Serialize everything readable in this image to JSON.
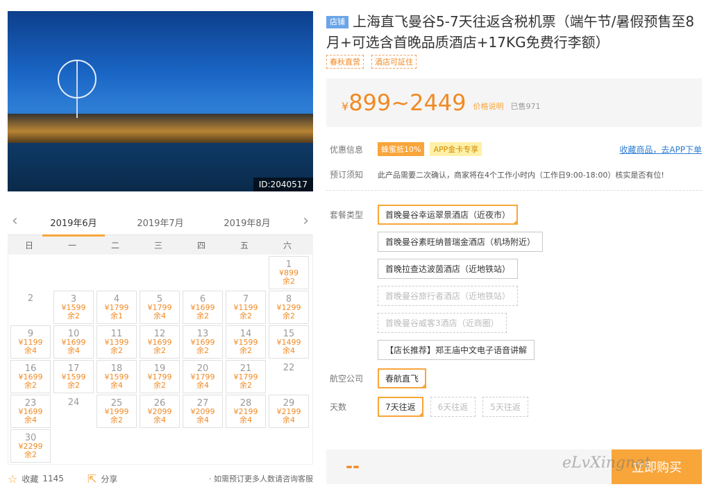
{
  "photo": {
    "id_label": "ID:2040517"
  },
  "calendar": {
    "months": [
      "2019年6月",
      "2019年7月",
      "2019年8月"
    ],
    "weekdays": [
      "日",
      "一",
      "二",
      "三",
      "四",
      "五",
      "六"
    ],
    "cells": [
      {
        "d": ""
      },
      {
        "d": ""
      },
      {
        "d": ""
      },
      {
        "d": ""
      },
      {
        "d": ""
      },
      {
        "d": ""
      },
      {
        "d": "1",
        "p": "¥899",
        "s": "余2"
      },
      {
        "d": "2"
      },
      {
        "d": "3",
        "p": "¥1599",
        "s": "余2"
      },
      {
        "d": "4",
        "p": "¥1799",
        "s": "余1"
      },
      {
        "d": "5",
        "p": "¥1799",
        "s": "余4"
      },
      {
        "d": "6",
        "p": "¥1699",
        "s": "余2"
      },
      {
        "d": "7",
        "p": "¥1199",
        "s": "余2"
      },
      {
        "d": "8",
        "p": "¥1299",
        "s": "余2"
      },
      {
        "d": "9",
        "p": "¥1199",
        "s": "余4"
      },
      {
        "d": "10",
        "p": "¥1699",
        "s": "余4"
      },
      {
        "d": "11",
        "p": "¥1399",
        "s": "余2"
      },
      {
        "d": "12",
        "p": "¥1699",
        "s": "余2"
      },
      {
        "d": "13",
        "p": "¥1699",
        "s": "余2"
      },
      {
        "d": "14",
        "p": "¥1599",
        "s": "余2"
      },
      {
        "d": "15",
        "p": "¥1499",
        "s": "余4"
      },
      {
        "d": "16",
        "p": "¥1699",
        "s": "余2"
      },
      {
        "d": "17",
        "p": "¥1599",
        "s": "余2"
      },
      {
        "d": "18",
        "p": "¥1599",
        "s": "余4"
      },
      {
        "d": "19",
        "p": "¥1799",
        "s": "余2"
      },
      {
        "d": "20",
        "p": "¥1799",
        "s": "余4"
      },
      {
        "d": "21",
        "p": "¥1799",
        "s": "余2"
      },
      {
        "d": "22"
      },
      {
        "d": "23",
        "p": "¥1699",
        "s": "余4"
      },
      {
        "d": "24"
      },
      {
        "d": "25",
        "p": "¥1999",
        "s": "余2"
      },
      {
        "d": "26",
        "p": "¥2099",
        "s": "余4"
      },
      {
        "d": "27",
        "p": "¥2099",
        "s": "余4"
      },
      {
        "d": "28",
        "p": "¥2199",
        "s": "余4"
      },
      {
        "d": "29",
        "p": "¥2199",
        "s": "余4"
      },
      {
        "d": "30",
        "p": "¥2299",
        "s": "余2"
      }
    ]
  },
  "footer": {
    "fav_label": "收藏",
    "fav_count": "1145",
    "share_label": "分享",
    "note": "· 如需预订更多人数请咨询客服"
  },
  "product": {
    "badge": "店铺",
    "title": "上海直飞曼谷5-7天往返含税机票（端午节/暑假预售至8月+可选含首晚品质酒店+17KG免费行李额）",
    "tags": [
      "春秋直营",
      "酒店可証住"
    ],
    "price_currency": "¥",
    "price": "899~2449",
    "price_explain": "价格说明",
    "sold": "已售971"
  },
  "promo": {
    "label": "优惠信息",
    "tag1": "蜂蜜抵10%",
    "tag2": "APP金卡专享",
    "fav_link": "收藏商品，去APP下单"
  },
  "notice": {
    "label": "预订须知",
    "text": "此产品需要二次确认，商家将在4个工作小时内（工作日9:00-18:00）核实是否有位!"
  },
  "package": {
    "label": "套餐类型",
    "options": [
      {
        "text": "首晚曼谷幸运翠景酒店（近夜市）",
        "state": "selected"
      },
      {
        "text": "首晚曼谷素旺纳普瑞金酒店（机场附近）",
        "state": "normal"
      },
      {
        "text": "首晚拉查达波茵酒店（近地铁站）",
        "state": "normal"
      },
      {
        "text": "首晚曼谷旅行者酒店（近地铁站）",
        "state": "disabled"
      },
      {
        "text": "首晚曼谷威客3酒店（近商圈）",
        "state": "disabled"
      },
      {
        "text": "【店长推荐】郑王庙中文电子语音讲解",
        "state": "normal"
      }
    ]
  },
  "airline": {
    "label": "航空公司",
    "option": "春航直飞"
  },
  "days": {
    "label": "天数",
    "options": [
      {
        "text": "7天往返",
        "state": "selected"
      },
      {
        "text": "6天往返",
        "state": "disabled"
      },
      {
        "text": "5天往返",
        "state": "disabled"
      }
    ]
  },
  "buy": {
    "price_placeholder": "--",
    "button": "立即购买"
  },
  "watermark": "eLvXingnet"
}
